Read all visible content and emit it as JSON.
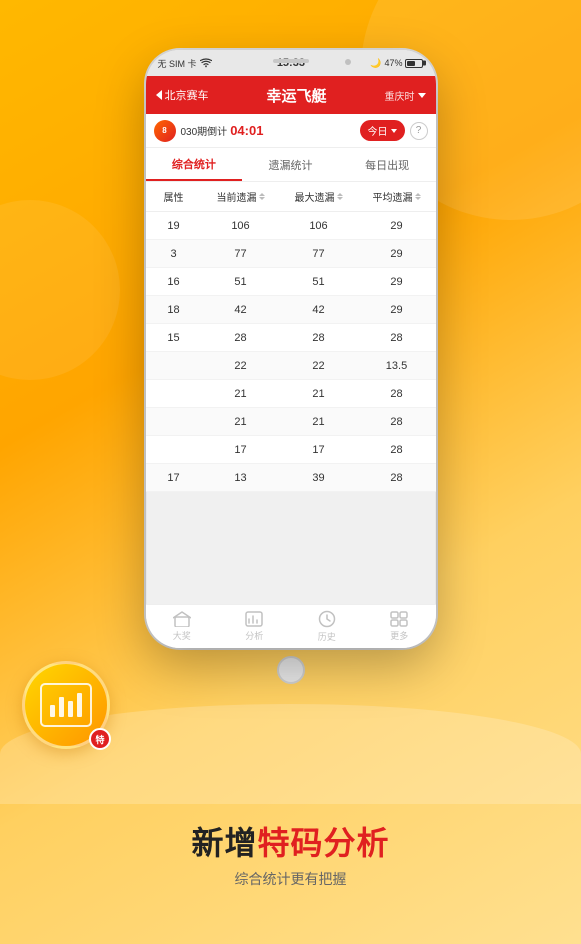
{
  "app": {
    "background": "#FFA500"
  },
  "status_bar": {
    "carrier": "无 SIM 卡",
    "wifi": "WiFi",
    "time": "15:33",
    "moon": "🌙",
    "battery_percent": "47%"
  },
  "nav": {
    "back_label": "北京赛车",
    "title": "幸运飞艇",
    "right_label": "重庆时时彩"
  },
  "sub_header": {
    "period": "030期倒计",
    "countdown": "04:01",
    "today_btn": "今日",
    "help": "?"
  },
  "tabs": [
    {
      "id": "comprehensive",
      "label": "综合统计",
      "active": true
    },
    {
      "id": "missed",
      "label": "遗漏统计",
      "active": false
    },
    {
      "id": "daily",
      "label": "每日出现",
      "active": false
    }
  ],
  "table": {
    "headers": [
      {
        "id": "attr",
        "label": "属性"
      },
      {
        "id": "current",
        "label": "当前遗漏"
      },
      {
        "id": "max",
        "label": "最大遗漏"
      },
      {
        "id": "avg",
        "label": "平均遗漏"
      }
    ],
    "rows": [
      {
        "attr": "19",
        "current": "106",
        "max": "106",
        "avg": "29"
      },
      {
        "attr": "3",
        "current": "77",
        "max": "77",
        "avg": "29"
      },
      {
        "attr": "16",
        "current": "51",
        "max": "51",
        "avg": "29"
      },
      {
        "attr": "18",
        "current": "42",
        "max": "42",
        "avg": "29"
      },
      {
        "attr": "15",
        "current": "28",
        "max": "28",
        "avg": "28"
      },
      {
        "attr": "",
        "current": "22",
        "max": "22",
        "avg": "13.5"
      },
      {
        "attr": "",
        "current": "21",
        "max": "21",
        "avg": "28"
      },
      {
        "attr": "",
        "current": "21",
        "max": "21",
        "avg": "28"
      },
      {
        "attr": "",
        "current": "17",
        "max": "17",
        "avg": "28"
      },
      {
        "attr": "17",
        "current": "13",
        "max": "39",
        "avg": "28"
      }
    ]
  },
  "bottom_nav": [
    {
      "id": "home",
      "label": "大奖"
    },
    {
      "id": "analysis",
      "label": "分析"
    },
    {
      "id": "history",
      "label": "历史"
    },
    {
      "id": "more",
      "label": "更多"
    }
  ],
  "feature": {
    "badge_label": "特",
    "main_title_prefix": "新增",
    "main_title_highlight": "特码分析",
    "sub_title": "综合统计更有把握"
  }
}
